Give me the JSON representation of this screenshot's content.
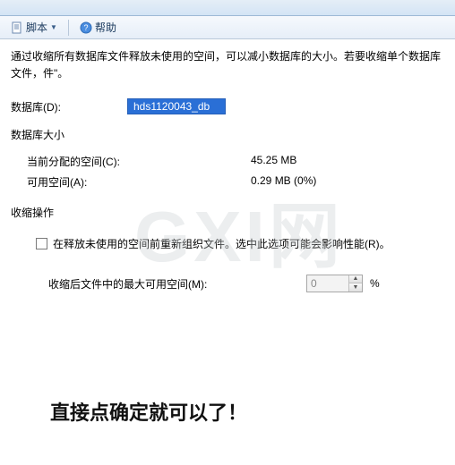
{
  "toolbar": {
    "script_label": "脚本",
    "help_label": "帮助"
  },
  "intro_text": "通过收缩所有数据库文件释放未使用的空间，可以减小数据库的大小。若要收缩单个数据库文件，件\"。",
  "database": {
    "label": "数据库(D):",
    "value": "hds1120043_db"
  },
  "size_section": {
    "title": "数据库大小",
    "allocated_label": "当前分配的空间(C):",
    "allocated_value": "45.25 MB",
    "free_label": "可用空间(A):",
    "free_value": "0.29 MB (0%)"
  },
  "shrink_section": {
    "title": "收缩操作",
    "reorganize_label": "在释放未使用的空间前重新组织文件。选中此选项可能会影响性能(R)。",
    "max_free_label": "收缩后文件中的最大可用空间(M):",
    "max_free_value": "0",
    "max_free_unit": "%"
  },
  "watermark": "GXI网",
  "bottom_hint": "直接点确定就可以了！"
}
